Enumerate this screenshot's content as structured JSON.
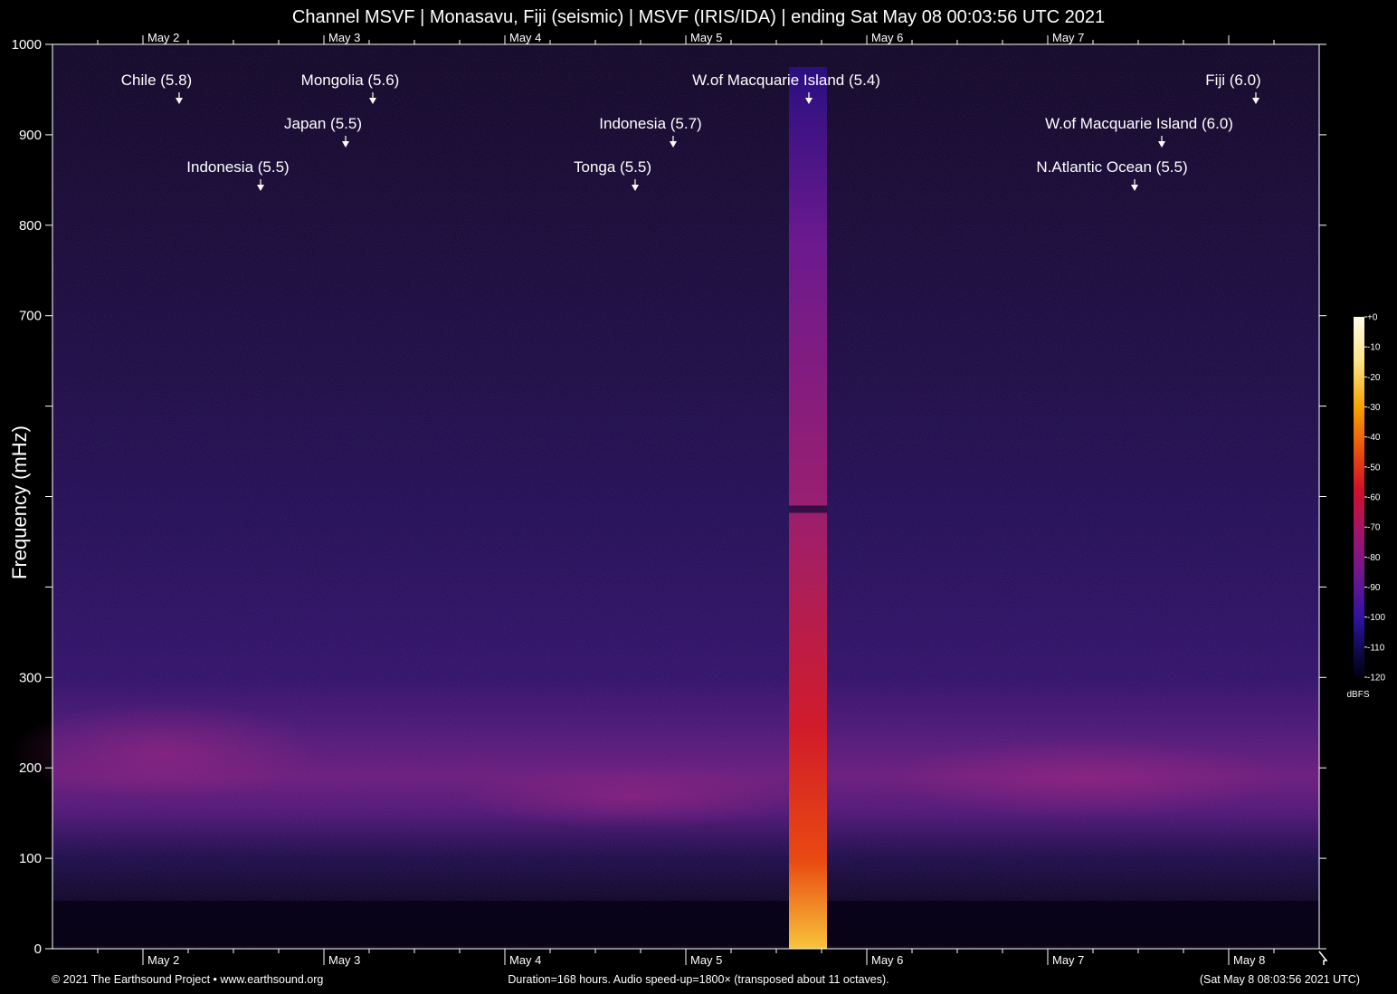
{
  "chart_data": {
    "type": "heatmap",
    "title": "Channel MSVF | Monasavu, Fiji (seismic) | MSVF (IRIS/IDA) | ending Sat May 08 00:03:56 UTC 2021",
    "ylabel": "Frequency (mHz)",
    "xlabel": "",
    "ylim": [
      0,
      1000
    ],
    "xlim_days": [
      1.5,
      8.5
    ],
    "y_ticks": [
      0,
      100,
      200,
      300,
      400,
      500,
      600,
      700,
      800,
      900,
      1000
    ],
    "y_tick_labels": [
      "0",
      "100",
      "200",
      "300",
      "",
      "",
      "",
      "700",
      "800",
      "900",
      "1000"
    ],
    "x_days": [
      {
        "label": "May 2",
        "day": 2
      },
      {
        "label": "May 3",
        "day": 3
      },
      {
        "label": "May 4",
        "day": 4
      },
      {
        "label": "May 5",
        "day": 5
      },
      {
        "label": "May 6",
        "day": 6
      },
      {
        "label": "May 7",
        "day": 7
      }
    ],
    "x_bottom_extra": [
      {
        "label": "May 8",
        "day": 8
      }
    ],
    "events": [
      {
        "label": "Chile (5.8)",
        "day": 2.2,
        "row": 1
      },
      {
        "label": "Mongolia (5.6)",
        "day": 3.27,
        "row": 1
      },
      {
        "label": "W.of Macquarie Island (5.4)",
        "day": 5.68,
        "row": 1
      },
      {
        "label": "Fiji (6.0)",
        "day": 8.15,
        "row": 1
      },
      {
        "label": "Japan (5.5)",
        "day": 3.12,
        "row": 2
      },
      {
        "label": "Indonesia (5.7)",
        "day": 4.93,
        "row": 2
      },
      {
        "label": "W.of Macquarie Island (6.0)",
        "day": 7.63,
        "row": 2
      },
      {
        "label": "Indonesia (5.5)",
        "day": 2.65,
        "row": 3
      },
      {
        "label": "Tonga (5.5)",
        "day": 4.72,
        "row": 3
      },
      {
        "label": "N.Atlantic Ocean (5.5)",
        "day": 7.48,
        "row": 3
      }
    ],
    "colorbar": {
      "unit": "dBFS",
      "ticks": [
        "+0",
        "-10",
        "-20",
        "-30",
        "-40",
        "-50",
        "-60",
        "-70",
        "-80",
        "-90",
        "-100",
        "-110",
        "-120"
      ]
    },
    "features": {
      "broadband_signal_days": [
        5.57,
        5.78
      ],
      "background_band_mhz": [
        140,
        280
      ]
    }
  },
  "footer": {
    "left": "© 2021 The Earthsound Project • www.earthsound.org",
    "center": "Duration=168 hours. Audio speed-up=1800× (transposed about 11 octaves).",
    "right": "(Sat May  8 08:03:56 2021 UTC)"
  }
}
